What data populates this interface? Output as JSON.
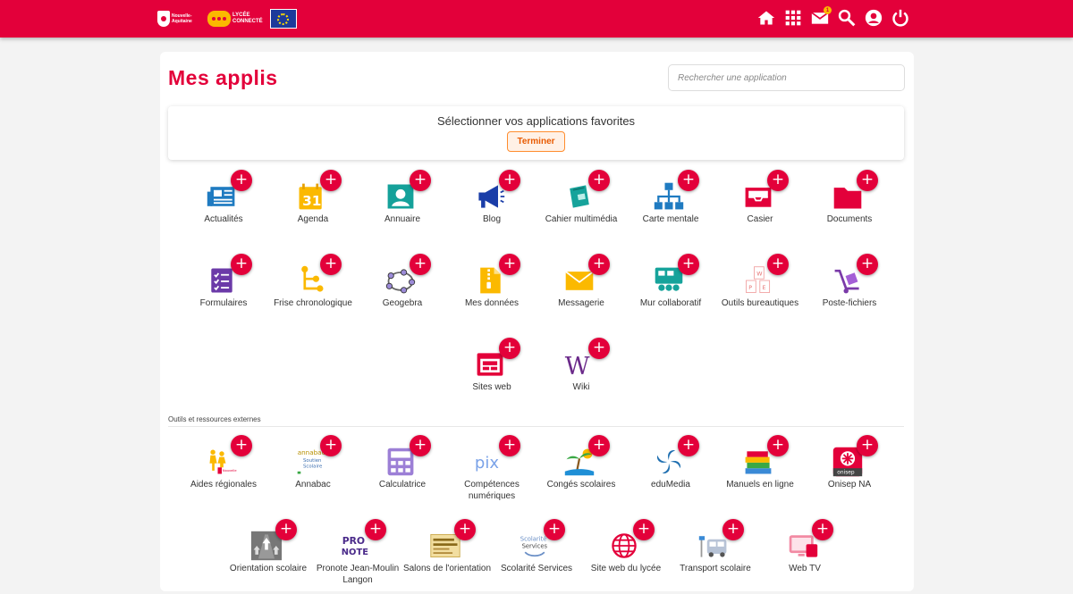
{
  "header": {
    "logo_region_line1": "Nouvelle-",
    "logo_region_line2": "Aquitaine",
    "logo_lycee_line1": "LYCÉE",
    "logo_lycee_line2": "CONNECTÉ",
    "notification_count": "1",
    "icons": [
      "home-icon",
      "apps-grid-icon",
      "mail-icon",
      "search-icon",
      "user-icon",
      "power-icon"
    ],
    "brand_color": "#e3003a"
  },
  "page": {
    "title": "Mes applis",
    "search_placeholder": "Rechercher une application"
  },
  "favorites": {
    "label": "Sélectionner vos applications favorites",
    "done_button": "Terminer"
  },
  "apps": [
    {
      "name": "Actualités",
      "icon": "newspaper-icon"
    },
    {
      "name": "Agenda",
      "icon": "calendar-icon"
    },
    {
      "name": "Annuaire",
      "icon": "contact-card-icon"
    },
    {
      "name": "Blog",
      "icon": "megaphone-icon"
    },
    {
      "name": "Cahier multimédia",
      "icon": "notebook-icon"
    },
    {
      "name": "Carte mentale",
      "icon": "mindmap-icon"
    },
    {
      "name": "Casier",
      "icon": "inbox-tray-icon"
    },
    {
      "name": "Documents",
      "icon": "folder-icon"
    },
    {
      "name": "Formulaires",
      "icon": "form-checklist-icon"
    },
    {
      "name": "Frise chronologique",
      "icon": "timeline-icon"
    },
    {
      "name": "Geogebra",
      "icon": "geogebra-icon"
    },
    {
      "name": "Mes données",
      "icon": "zip-file-icon"
    },
    {
      "name": "Messagerie",
      "icon": "envelope-icon"
    },
    {
      "name": "Mur collaboratif",
      "icon": "collaborative-wall-icon"
    },
    {
      "name": "Outils bureautiques",
      "icon": "office-docs-icon"
    },
    {
      "name": "Poste-fichiers",
      "icon": "hand-truck-icon"
    },
    {
      "name": "Sites web",
      "icon": "website-icon"
    },
    {
      "name": "Wiki",
      "icon": "wiki-icon"
    }
  ],
  "external_section_label": "Outils et ressources externes",
  "external_apps": [
    {
      "name": "Aides régionales",
      "icon": "family-icon"
    },
    {
      "name": "Annabac",
      "icon": "annabac-icon"
    },
    {
      "name": "Calculatrice",
      "icon": "calculator-icon"
    },
    {
      "name": "Compétences numériques",
      "icon": "pix-icon"
    },
    {
      "name": "Congés scolaires",
      "icon": "beach-icon"
    },
    {
      "name": "eduMedia",
      "icon": "edumedia-icon"
    },
    {
      "name": "Manuels en ligne",
      "icon": "books-icon"
    },
    {
      "name": "Onisep NA",
      "icon": "onisep-icon"
    },
    {
      "name": "Orientation scolaire",
      "icon": "road-arrows-icon"
    },
    {
      "name": "Pronote Jean-Moulin Langon",
      "icon": "pronote-icon"
    },
    {
      "name": "Salons de l'orientation",
      "icon": "salons-icon"
    },
    {
      "name": "Scolarité Services",
      "icon": "scolarite-icon"
    },
    {
      "name": "Site web du lycée",
      "icon": "globe-icon"
    },
    {
      "name": "Transport scolaire",
      "icon": "bus-icon"
    },
    {
      "name": "Web TV",
      "icon": "web-tv-icon"
    }
  ],
  "logo_texts": {
    "annabac": "annabac",
    "annabac_sub1": "Soutien",
    "annabac_sub2": "Scolaire",
    "pix": "pix",
    "onisep": "onisep",
    "pronote1": "PRO",
    "pronote2": "NOTE",
    "scolarite1": "Scolarité",
    "scolarite2": "Services"
  }
}
